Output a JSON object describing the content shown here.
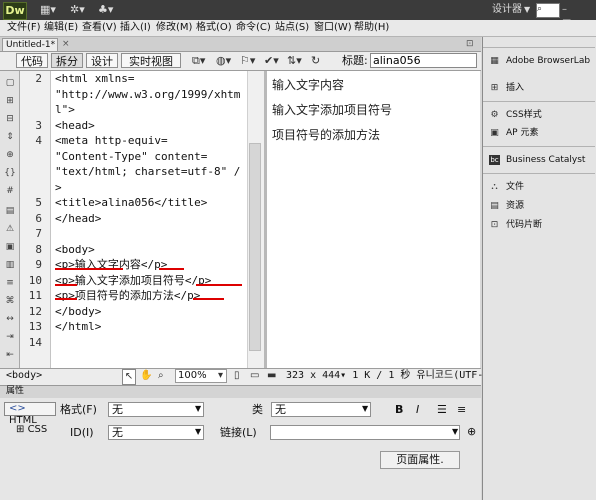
{
  "app": {
    "logo": "Dw",
    "workspace": "设计器",
    "tab_title": "Untitled-1*",
    "tab_close": "×",
    "tab_path": "⊡"
  },
  "menu": [
    "文件(F)",
    "编辑(E)",
    "查看(V)",
    "插入(I)",
    "修改(M)",
    "格式(O)",
    "命令(C)",
    "站点(S)",
    "窗口(W)",
    "帮助(H)"
  ],
  "toolbar": {
    "code_label": "代码",
    "split_label": "拆分",
    "design_label": "设计",
    "live_label": "实时视图",
    "title_label": "标题:",
    "title_value": "alina056"
  },
  "code_lines": [
    {
      "n": "2",
      "t": "<html xmlns="
    },
    {
      "n": "",
      "t": "\"http://www.w3.org/1999/xhtm"
    },
    {
      "n": "",
      "t": "l\">"
    },
    {
      "n": "3",
      "t": "<head>"
    },
    {
      "n": "4",
      "t": "<meta http-equiv="
    },
    {
      "n": "",
      "t": "\"Content-Type\" content="
    },
    {
      "n": "",
      "t": "\"text/html; charset=utf-8\" /"
    },
    {
      "n": "",
      "t": ">"
    },
    {
      "n": "5",
      "t": "<title>alina056</title>"
    },
    {
      "n": "6",
      "t": "</head>"
    },
    {
      "n": "7",
      "t": ""
    },
    {
      "n": "8",
      "t": "<body>"
    },
    {
      "n": "9",
      "t": "<p>输入文字内容</p>"
    },
    {
      "n": "10",
      "t": "<p>输入文字添加项目符号</p>"
    },
    {
      "n": "11",
      "t": "<p>项目符号的添加方法</p>"
    },
    {
      "n": "12",
      "t": "</body>"
    },
    {
      "n": "13",
      "t": "</html>"
    },
    {
      "n": "14",
      "t": ""
    }
  ],
  "design_paragraphs": [
    "输入文字内容",
    "输入文字添加项目符号",
    "项目符号的添加方法"
  ],
  "status": {
    "tag": "<body>",
    "zoom": "100%",
    "info": "323 x 444▾ 1 K / 1 秒 유니코드(UTF-"
  },
  "properties": {
    "title": "属性",
    "html_btn": "HTML",
    "css_btn": "CSS",
    "format_label": "格式(F)",
    "format_value": "无",
    "id_label": "ID(I)",
    "id_value": "无",
    "class_label": "类",
    "class_value": "无",
    "link_label": "链接(L)",
    "link_value": "",
    "bold": "B",
    "italic": "I",
    "page_props": "页面属性."
  },
  "right_panel": {
    "items": [
      "Adobe BrowserLab",
      "插入",
      "CSS样式",
      "AP 元素",
      "Business Catalyst",
      "文件",
      "资源",
      "代码片断"
    ]
  }
}
